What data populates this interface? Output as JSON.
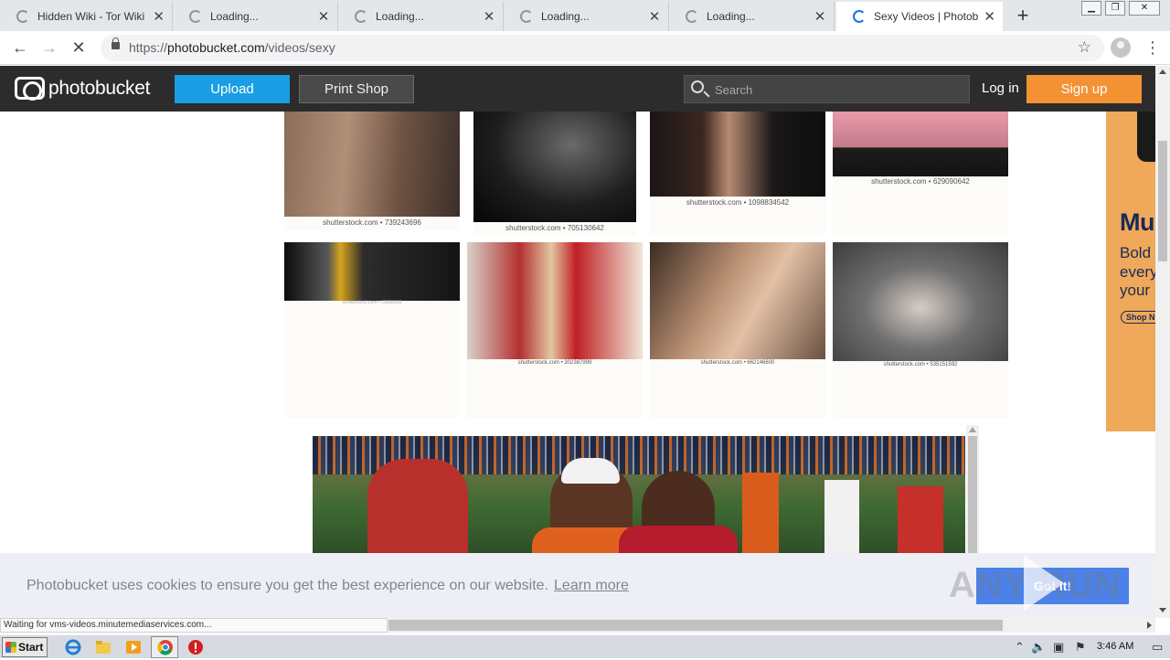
{
  "browser": {
    "tabs": [
      {
        "title": "Hidden Wiki - Tor Wiki - D",
        "active": false
      },
      {
        "title": "Loading...",
        "active": false
      },
      {
        "title": "Loading...",
        "active": false
      },
      {
        "title": "Loading...",
        "active": false
      },
      {
        "title": "Loading...",
        "active": false
      },
      {
        "title": "Sexy Videos | Photobuck",
        "active": true
      }
    ],
    "url_prefix": "https://",
    "url_host": "photobucket.com",
    "url_path": "/videos/sexy"
  },
  "header": {
    "logo_text": "photobucket",
    "upload_label": "Upload",
    "print_shop_label": "Print Shop",
    "search_placeholder": "Search",
    "login_label": "Log in",
    "signup_label": "Sign up"
  },
  "gallery": [
    {
      "caption": "shutterstock.com • 739243696",
      "style": "t-torso"
    },
    {
      "caption": "shutterstock.com • 705130642",
      "style": "t-bw"
    },
    {
      "caption": "shutterstock.com • 1098834542",
      "style": "t-couple1"
    },
    {
      "caption": "shutterstock.com • 629090642",
      "style": "t-pink"
    },
    {
      "caption": "shutterstock.com • 13858008",
      "style": "t-gold"
    },
    {
      "caption": "shutterstock.com • 302387999",
      "style": "t-party"
    },
    {
      "caption": "shutterstock.com • 662146600",
      "style": "t-kiss"
    },
    {
      "caption": "shutterstock.com • 535151592",
      "style": "t-grey"
    }
  ],
  "ad": {
    "headline": "Mu",
    "lines": [
      "Bold",
      "every",
      "your"
    ],
    "button": "Shop N"
  },
  "cookie": {
    "message": "Photobucket uses cookies to ensure you get the best experience on our website.",
    "learn_more": "Learn more",
    "accept": "Got it!"
  },
  "watermark": "ANY RUN",
  "status": "Waiting for vms-videos.minutemediaservices.com...",
  "taskbar": {
    "start_label": "Start",
    "clock": "3:46 AM"
  },
  "colors": {
    "header_bg": "#2c2c2c",
    "upload_blue": "#1a9ee3",
    "signup_orange": "#f39233",
    "cookie_button": "#4b81e8"
  }
}
